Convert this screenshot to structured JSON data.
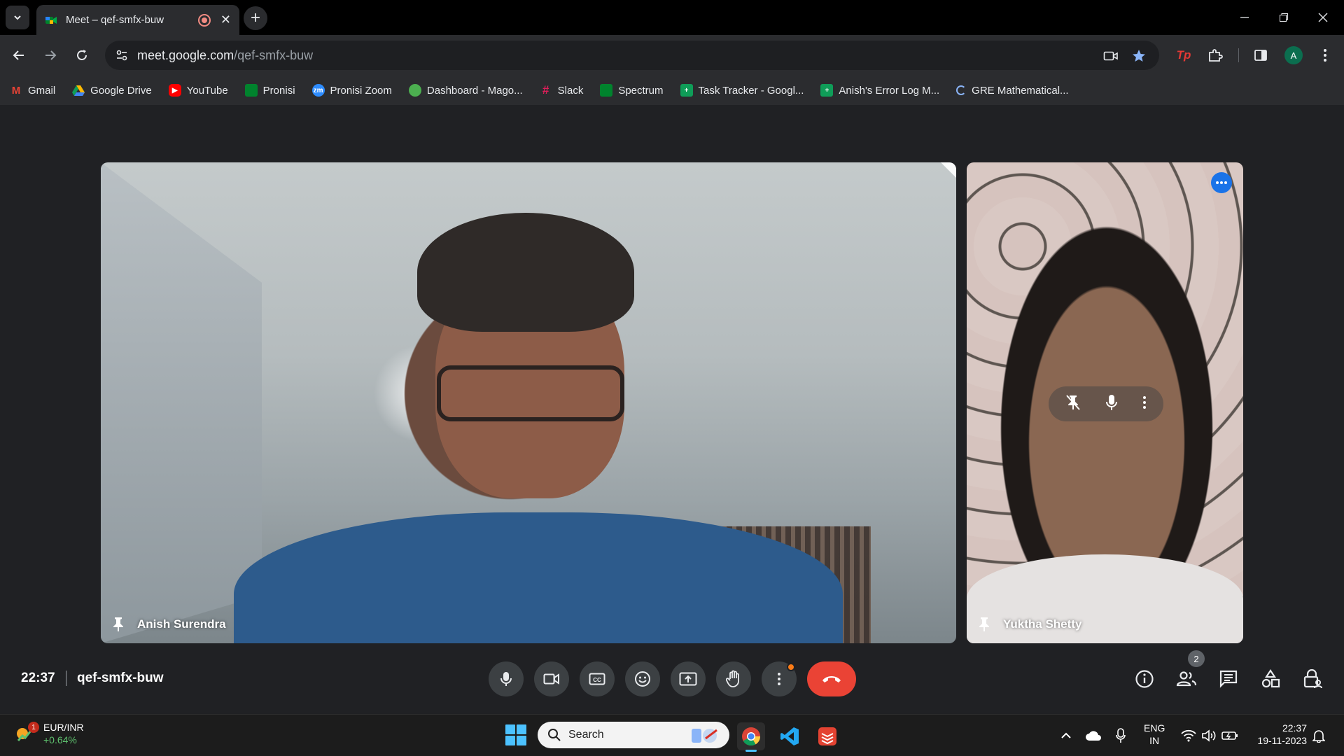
{
  "browser": {
    "tab_title": "Meet – qef-smfx-buw",
    "url_host": "meet.google.com",
    "url_path": "/qef-smfx-buw",
    "profile_initial": "A"
  },
  "bookmarks": [
    {
      "label": "Gmail",
      "icon": "gmail-icon",
      "color": "#ea4335"
    },
    {
      "label": "Google Drive",
      "icon": "google-drive-icon",
      "color": "#34a853"
    },
    {
      "label": "YouTube",
      "icon": "youtube-icon",
      "color": "#ff0000"
    },
    {
      "label": "Pronisi",
      "icon": "meet-icon",
      "color": "#00897b"
    },
    {
      "label": "Pronisi Zoom",
      "icon": "zoom-icon",
      "color": "#2d8cff"
    },
    {
      "label": "Dashboard - Mago...",
      "icon": "dashboard-icon",
      "color": "#4caf50"
    },
    {
      "label": "Slack",
      "icon": "slack-icon",
      "color": "#e01e5a"
    },
    {
      "label": "Spectrum",
      "icon": "meet-icon",
      "color": "#00897b"
    },
    {
      "label": "Task Tracker - Googl...",
      "icon": "sheets-icon",
      "color": "#0f9d58"
    },
    {
      "label": "Anish's Error Log M...",
      "icon": "sheets-icon",
      "color": "#0f9d58"
    },
    {
      "label": "GRE Mathematical...",
      "icon": "loading-icon",
      "color": "#8ab4f8"
    }
  ],
  "meet": {
    "participants": [
      {
        "name": "Anish Surendra"
      },
      {
        "name": "Yuktha Shetty"
      }
    ],
    "time": "22:37",
    "meeting_code": "qef-smfx-buw",
    "people_count": "2"
  },
  "taskbar": {
    "widget_pair": "EUR/INR",
    "widget_change": "+0.64%",
    "widget_badge": "1",
    "search_label": "Search",
    "lang_line1": "ENG",
    "lang_line2": "IN",
    "time": "22:37",
    "date": "19-11-2023"
  },
  "colors": {
    "hangup": "#ea4335",
    "accent_blue": "#1a73e8",
    "notification_dot": "#fa7b17"
  }
}
